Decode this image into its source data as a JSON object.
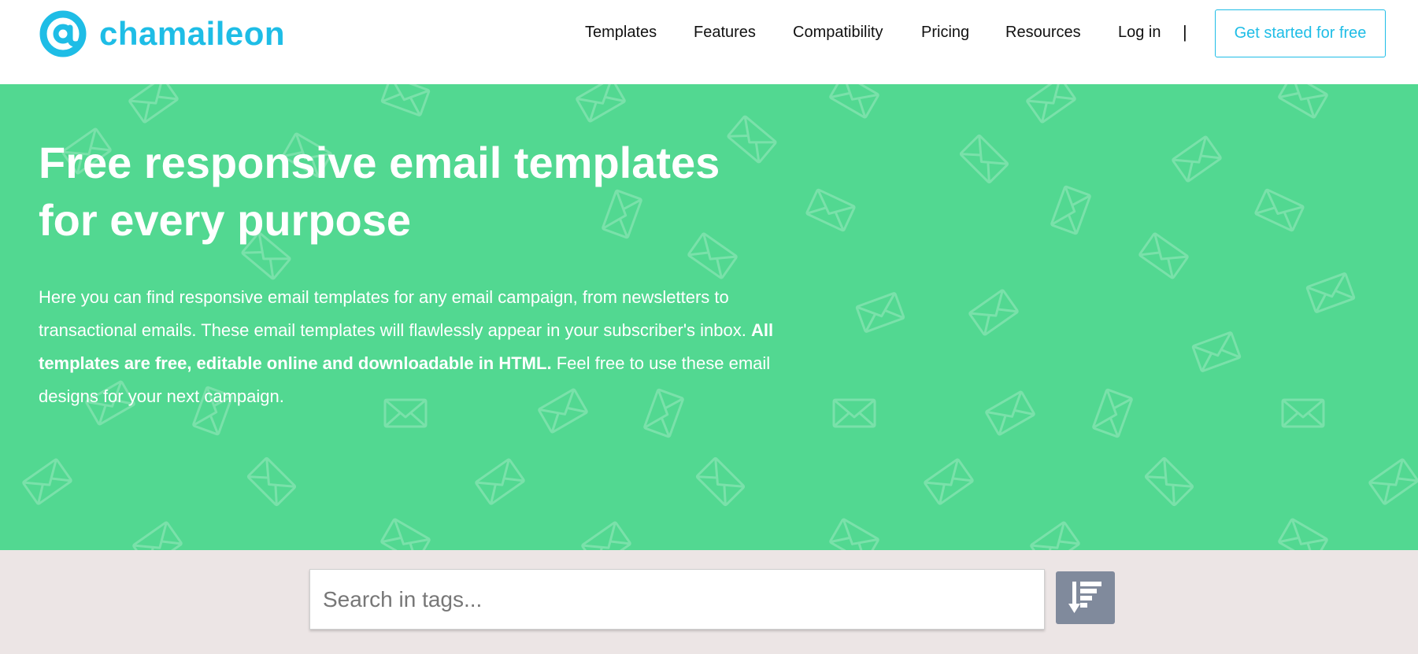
{
  "brand": {
    "name": "chamaileon",
    "logo_icon": "at-sign-icon",
    "color": "#1ebde6"
  },
  "nav": {
    "items": [
      {
        "label": "Templates"
      },
      {
        "label": "Features"
      },
      {
        "label": "Compatibility"
      },
      {
        "label": "Pricing"
      },
      {
        "label": "Resources"
      },
      {
        "label": "Log in"
      }
    ],
    "separator": "|",
    "cta_label": "Get started for free"
  },
  "hero": {
    "title_line1": "Free responsive email templates",
    "title_line2": "for every purpose",
    "desc_part1": "Here you can find responsive email templates for any email campaign, from newsletters to transactional emails. These email templates will flawlessly appear in your subscriber's inbox.",
    "desc_bold": "All templates are free, editable online and downloadable in HTML.",
    "desc_part2": "Feel free to use these email designs for your next campaign.",
    "background_color": "#52d891",
    "pattern_icon": "envelope-icon"
  },
  "search": {
    "placeholder": "Search in tags...",
    "value": "",
    "sort_icon": "sort-descending-icon"
  }
}
